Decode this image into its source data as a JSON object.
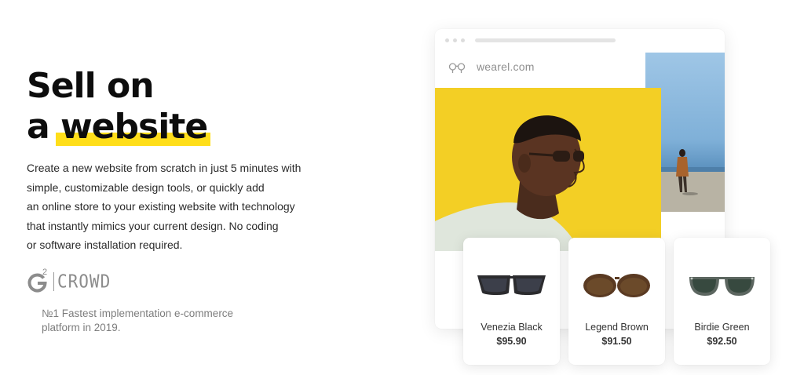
{
  "hero": {
    "headline_line1": "Sell on",
    "headline_line2_prefix": "a",
    "headline_highlight": "website",
    "description_lines": [
      "Create a new website from scratch in just 5 minutes with",
      "simple, customizable design tools, or quickly add",
      "an online store to your existing website with technology",
      "that instantly mimics your current design. No coding",
      "or software installation required."
    ],
    "highlight_color": "#ffde1a"
  },
  "badge": {
    "logo_mark": "G",
    "logo_superscript": "2",
    "logo_word": "CROWD",
    "award_lines": [
      "№1 Fastest implementation e-commerce",
      "platform in 2019."
    ]
  },
  "browser": {
    "domain": "wearel.com",
    "site_logo_icon": "eyeglasses-icon",
    "main_photo_bg": "#f3cf25",
    "side_photo_bg": "#8cbce0"
  },
  "products": [
    {
      "name": "Venezia Black",
      "price": "$95.90",
      "frame_color": "#2b2b2e",
      "lens_color": "#3c3f4a"
    },
    {
      "name": "Legend Brown",
      "price": "$91.50",
      "frame_color": "#5a3a22",
      "lens_color": "#6b4a2a"
    },
    {
      "name": "Birdie Green",
      "price": "$92.50",
      "frame_color": "#5c6660",
      "lens_color": "#37493f"
    }
  ]
}
